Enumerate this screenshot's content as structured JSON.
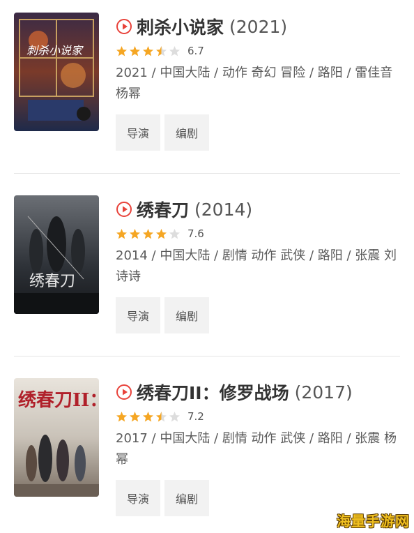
{
  "colors": {
    "accent": "#e8423a",
    "star_on": "#f5a623",
    "star_off": "#dddddd"
  },
  "movies": [
    {
      "title": "刺杀小说家",
      "year": "(2021)",
      "rating": 6.7,
      "rating_text": "6.7",
      "stars": 3.5,
      "meta": "2021 / 中国大陆 / 动作 奇幻 冒险 / 路阳 / 雷佳音 杨幂",
      "buttons": [
        "导演",
        "编剧"
      ]
    },
    {
      "title": "绣春刀",
      "year": "(2014)",
      "rating": 7.6,
      "rating_text": "7.6",
      "stars": 4,
      "meta": "2014 / 中国大陆 / 剧情 动作 武侠 / 路阳 / 张震 刘诗诗",
      "buttons": [
        "导演",
        "编剧"
      ]
    },
    {
      "title": "绣春刀II：修罗战场",
      "year": "(2017)",
      "rating": 7.2,
      "rating_text": "7.2",
      "stars": 3.5,
      "meta": "2017 / 中国大陆 / 剧情 动作 武侠 / 路阳 / 张震 杨幂",
      "buttons": [
        "导演",
        "编剧"
      ]
    }
  ],
  "watermark": "海量手游网"
}
